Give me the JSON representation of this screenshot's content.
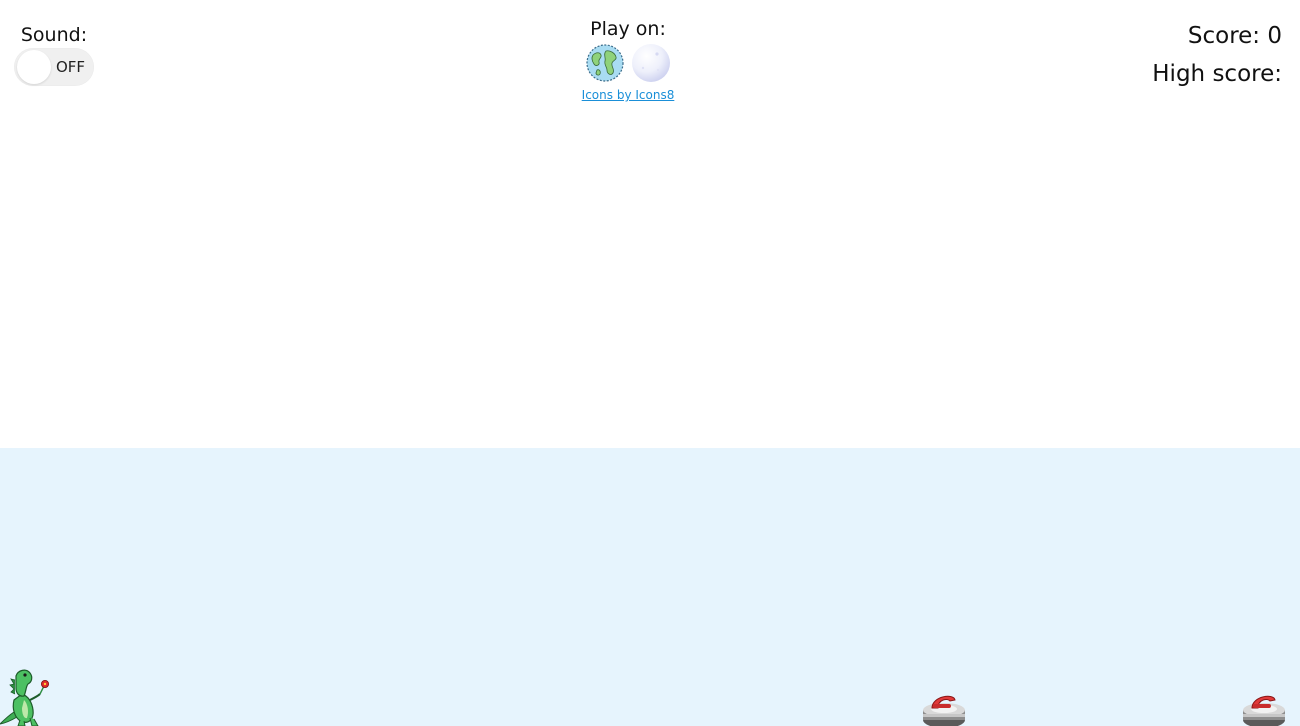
{
  "sound": {
    "label": "Sound:",
    "toggle_state": "OFF"
  },
  "play_on": {
    "label": "Play on:",
    "options": [
      {
        "icon": "earth-icon"
      },
      {
        "icon": "moon-icon"
      }
    ],
    "credit_link": "Icons by Icons8"
  },
  "score": {
    "score_label": "Score: 0",
    "high_score_label": "High score:"
  },
  "game": {
    "ground_color": "#e6f4fd",
    "player_icon": "dinosaur-icon",
    "obstacle_icon": "curling-stone-icon"
  }
}
